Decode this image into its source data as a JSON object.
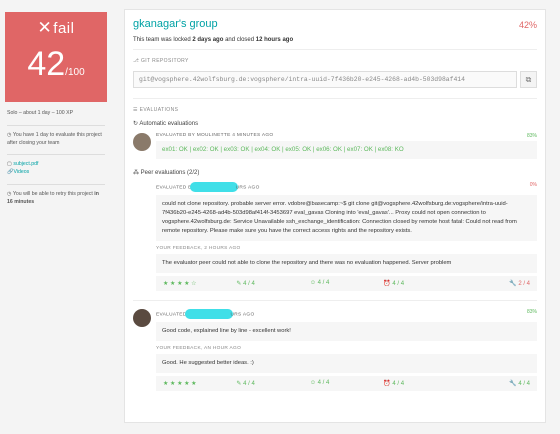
{
  "left": {
    "fail_label": "fail",
    "score": "42",
    "score_max": "/100",
    "meta": "Solo – about 1 day – 100 XP",
    "eval_notice": "You have 1 day to evaluate this project after closing your team",
    "subject": "subject.pdf",
    "videos": "Videos",
    "retry_prefix": "You will be able to retry this project",
    "retry_time": "in 16 minutes"
  },
  "header": {
    "group": "gkanagar's group",
    "percent": "42%",
    "locked_text_1": "This team was locked",
    "locked_bold_1": "2 days ago",
    "locked_text_2": "and closed",
    "locked_bold_2": "12 hours ago"
  },
  "git": {
    "title": "GIT REPOSITORY",
    "url": "git@vogsphere.42wolfsburg.de:vogsphere/intra-uuid-7f436b20-e245-4268-ad4b-503d98af414"
  },
  "evaluations": {
    "title": "EVALUATIONS",
    "automatic_title": "Automatic evaluations",
    "auto": {
      "by": "EVALUATED BY MOULINETTE 4 MINUTES AGO",
      "pct": "83%",
      "result": "ex01: OK | ex02: OK | ex03: OK | ex04: OK | ex05: OK | ex06: OK | ex07: OK | ex08: KO"
    },
    "peer_title": "Peer evaluations (2/2)",
    "peer1": {
      "by_prefix": "EVALUATED B",
      "by_suffix": "URS AGO",
      "pct": "0%",
      "comment": "could not clone repository. probable server error. vdobre@basecamp:~$ git clone git@vogsphere.42wolfsburg.de:vogsphere/intra-uuid-7f436b20-e245-4268-ad4b-503d98af414f-3453697 eval_gavas Cloning into 'eval_gavas'... Proxy could not open connection to vogsphere.42wolfsburg.de: Service Unavailable ssh_exchange_identification: Connection closed by remote host fatal: Could not read from remote repository. Please make sure you have the correct access rights and the repository exists.",
      "feedback_label": "YOUR FEEDBACK, 2 HOURS AGO",
      "feedback": "The evaluator peer could not able to clone the repository and there was no evaluation happened. Server problem",
      "stars": "★ ★ ★ ★ ☆",
      "r1": "4 / 4",
      "r2": "4 / 4",
      "r3": "4 / 4",
      "r4": "2 / 4"
    },
    "peer2": {
      "by_prefix": "EVALUATED",
      "by_suffix": "URS AGO",
      "pct": "83%",
      "comment": "Good code, explained line by line - excellent work!",
      "feedback_label": "YOUR FEEDBACK, AN HOUR AGO",
      "feedback": "Good. He suggested better ideas. :)",
      "stars": "★ ★ ★ ★ ★",
      "r1": "4 / 4",
      "r2": "4 / 4",
      "r3": "4 / 4",
      "r4": "4 / 4"
    }
  }
}
